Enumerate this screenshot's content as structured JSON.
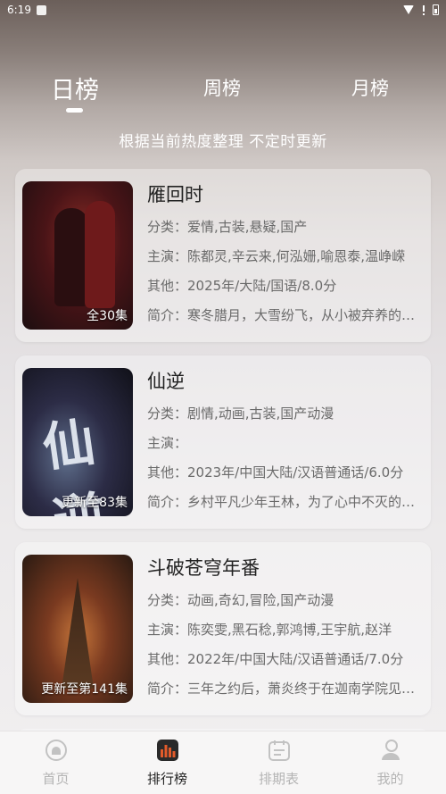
{
  "status_bar": {
    "time": "6:19"
  },
  "tabs": [
    {
      "label": "日榜",
      "active": true
    },
    {
      "label": "周榜",
      "active": false
    },
    {
      "label": "月榜",
      "active": false
    }
  ],
  "subtitle": "根据当前热度整理 不定时更新",
  "items": [
    {
      "title": "雁回时",
      "poster_caption": "全30集",
      "category": "分类：爱情,古装,悬疑,国产",
      "cast": "主演：陈都灵,辛云来,何泓姗,喻恩泰,温峥嵘",
      "other": "其他：2025年/大陆/国语/8.0分",
      "intro": "简介：寒冬腊月，大雪纷飞，从小被弃养的庄寒雁"
    },
    {
      "title": "仙逆",
      "poster_caption": "更新至83集",
      "category": "分类：剧情,动画,古装,国产动漫",
      "cast": "主演：",
      "other": "其他：2023年/中国大陆/汉语普通话/6.0分",
      "intro": "简介：乡村平凡少年王林，为了心中不灭的梦想"
    },
    {
      "title": "斗破苍穹年番",
      "poster_caption": "更新至第141集",
      "category": "分类：动画,奇幻,冒险,国产动漫",
      "cast": "主演：陈奕雯,黑石稔,郭鸿博,王宇航,赵洋",
      "other": "其他：2022年/中国大陆/汉语普通话/7.0分",
      "intro": "简介：三年之约后，萧炎终于在迦南学院见到了"
    }
  ],
  "bottom_nav": [
    {
      "label": "首页",
      "icon": "home-icon",
      "active": false
    },
    {
      "label": "排行榜",
      "icon": "ranking-icon",
      "active": true
    },
    {
      "label": "排期表",
      "icon": "schedule-icon",
      "active": false
    },
    {
      "label": "我的",
      "icon": "profile-icon",
      "active": false
    }
  ],
  "colors": {
    "accent": "#e35b2b",
    "inactive": "#b4b4b4"
  }
}
